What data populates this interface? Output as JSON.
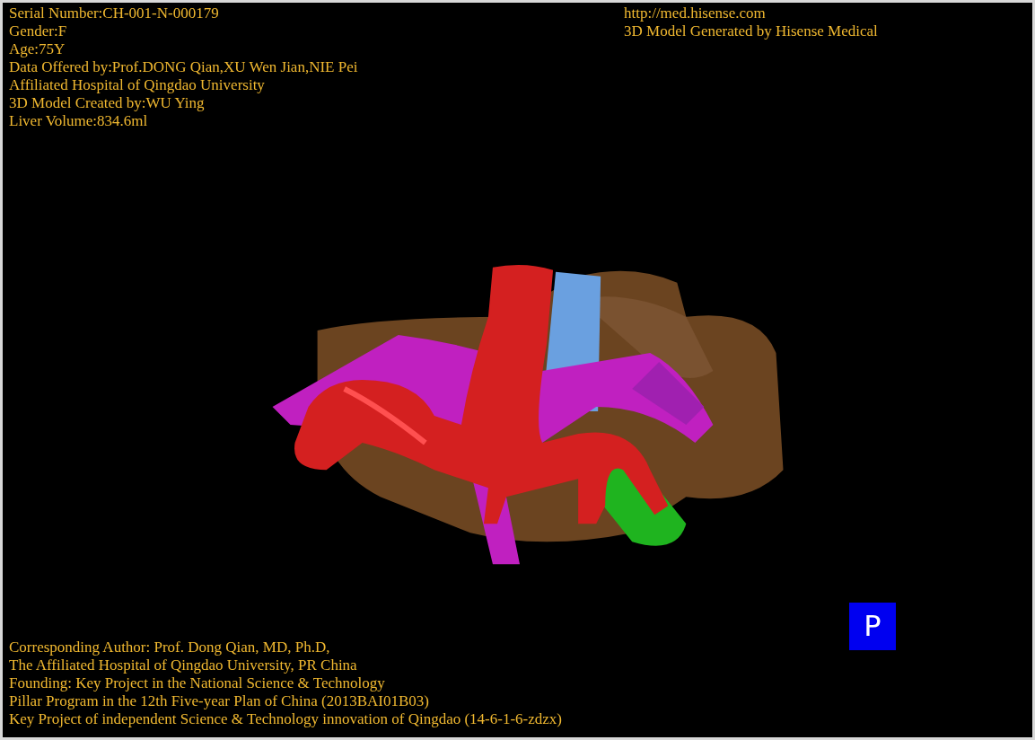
{
  "info_top_left": [
    "Serial Number:CH-001-N-000179",
    "Gender:F",
    "Age:75Y",
    "Data Offered by:Prof.DONG Qian,XU Wen Jian,NIE Pei",
    "Affiliated Hospital of Qingdao University",
    "3D Model Created by:WU Ying",
    "Liver Volume:834.6ml"
  ],
  "info_top_right": [
    "http://med.hisense.com",
    "3D Model Generated by Hisense Medical"
  ],
  "info_bottom": [
    "Corresponding Author: Prof. Dong Qian, MD, Ph.D,",
    "The Affiliated Hospital of Qingdao University, PR China",
    "Founding: Key Project in the National Science & Technology",
    "Pillar Program in the 12th Five-year Plan of China (2013BAI01B03)",
    "Key Project of independent Science & Technology innovation of Qingdao (14-6-1-6-zdzx)"
  ],
  "view_badge": "P"
}
